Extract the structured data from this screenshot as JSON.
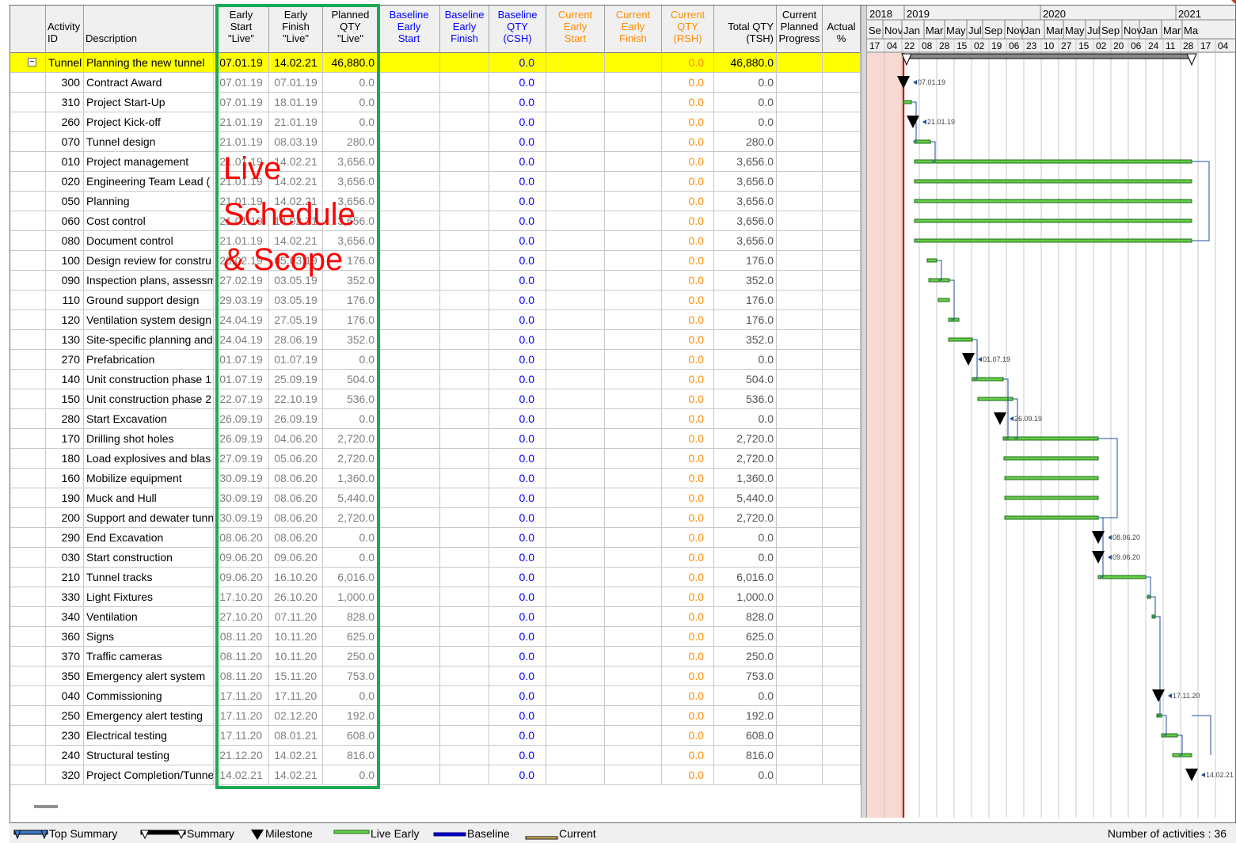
{
  "columns": {
    "id": "Activity\nID",
    "desc": "Description",
    "es": "Early\nStart\n\"Live\"",
    "ef": "Early\nFinish\n\"Live\"",
    "pq": "Planned\nQTY\n\"Live\"",
    "bes": "Baseline\nEarly\nStart",
    "bef": "Baseline\nEarly\nFinish",
    "bq": "Baseline\nQTY\n(CSH)",
    "ces": "Current\nEarly\nStart",
    "cef": "Current\nEarly\nFinish",
    "cq": "Current\nQTY\n(RSH)",
    "tq": "Total QTY\n(TSH)",
    "cpp": "Current\nPlanned\nProgress",
    "ap": "Actual\n%"
  },
  "summary_row": {
    "id": "Tunnel",
    "desc": "Planning the new tunnel",
    "es": "07.01.19",
    "ef": "14.02.21",
    "pq": "46,880.0",
    "bq": "0.0",
    "cq": "0.0",
    "tq": "46,880.0"
  },
  "rows": [
    {
      "id": "300",
      "desc": "Contract Award",
      "es": "07.01.19",
      "ef": "07.01.19",
      "pq": "0.0",
      "bq": "0.0",
      "cq": "0.0",
      "tq": "0.0"
    },
    {
      "id": "310",
      "desc": "Project Start-Up",
      "es": "07.01.19",
      "ef": "18.01.19",
      "pq": "0.0",
      "bq": "0.0",
      "cq": "0.0",
      "tq": "0.0"
    },
    {
      "id": "260",
      "desc": "Project Kick-off",
      "es": "21.01.19",
      "ef": "21.01.19",
      "pq": "0.0",
      "bq": "0.0",
      "cq": "0.0",
      "tq": "0.0"
    },
    {
      "id": "070",
      "desc": "Tunnel design",
      "es": "21.01.19",
      "ef": "08.03.19",
      "pq": "280.0",
      "bq": "0.0",
      "cq": "0.0",
      "tq": "280.0"
    },
    {
      "id": "010",
      "desc": "Project management",
      "es": "21.01.19",
      "ef": "14.02.21",
      "pq": "3,656.0",
      "bq": "0.0",
      "cq": "0.0",
      "tq": "3,656.0"
    },
    {
      "id": "020",
      "desc": "Engineering Team Lead (",
      "es": "21.01.19",
      "ef": "14.02.21",
      "pq": "3,656.0",
      "bq": "0.0",
      "cq": "0.0",
      "tq": "3,656.0"
    },
    {
      "id": "050",
      "desc": "Planning",
      "es": "21.01.19",
      "ef": "14.02.21",
      "pq": "3,656.0",
      "bq": "0.0",
      "cq": "0.0",
      "tq": "3,656.0"
    },
    {
      "id": "060",
      "desc": "Cost control",
      "es": "21.01.19",
      "ef": "14.02.21",
      "pq": "3,656.0",
      "bq": "0.0",
      "cq": "0.0",
      "tq": "3,656.0"
    },
    {
      "id": "080",
      "desc": "Document control",
      "es": "21.01.19",
      "ef": "14.02.21",
      "pq": "3,656.0",
      "bq": "0.0",
      "cq": "0.0",
      "tq": "3,656.0"
    },
    {
      "id": "100",
      "desc": "Design review for constru",
      "es": "20.02.19",
      "ef": "05.03.19",
      "pq": "176.0",
      "bq": "0.0",
      "cq": "0.0",
      "tq": "176.0"
    },
    {
      "id": "090",
      "desc": "Inspection plans, assessm",
      "es": "27.02.19",
      "ef": "03.05.19",
      "pq": "352.0",
      "bq": "0.0",
      "cq": "0.0",
      "tq": "352.0"
    },
    {
      "id": "110",
      "desc": "Ground support design",
      "es": "29.03.19",
      "ef": "03.05.19",
      "pq": "176.0",
      "bq": "0.0",
      "cq": "0.0",
      "tq": "176.0"
    },
    {
      "id": "120",
      "desc": "Ventilation system design",
      "es": "24.04.19",
      "ef": "27.05.19",
      "pq": "176.0",
      "bq": "0.0",
      "cq": "0.0",
      "tq": "176.0"
    },
    {
      "id": "130",
      "desc": "Site-specific planning and",
      "es": "24.04.19",
      "ef": "28.06.19",
      "pq": "352.0",
      "bq": "0.0",
      "cq": "0.0",
      "tq": "352.0"
    },
    {
      "id": "270",
      "desc": "Prefabrication",
      "es": "01.07.19",
      "ef": "01.07.19",
      "pq": "0.0",
      "bq": "0.0",
      "cq": "0.0",
      "tq": "0.0"
    },
    {
      "id": "140",
      "desc": "Unit construction phase 1",
      "es": "01.07.19",
      "ef": "25.09.19",
      "pq": "504.0",
      "bq": "0.0",
      "cq": "0.0",
      "tq": "504.0"
    },
    {
      "id": "150",
      "desc": "Unit construction phase 2",
      "es": "22.07.19",
      "ef": "22.10.19",
      "pq": "536.0",
      "bq": "0.0",
      "cq": "0.0",
      "tq": "536.0"
    },
    {
      "id": "280",
      "desc": "Start Excavation",
      "es": "26.09.19",
      "ef": "26.09.19",
      "pq": "0.0",
      "bq": "0.0",
      "cq": "0.0",
      "tq": "0.0"
    },
    {
      "id": "170",
      "desc": "Drilling shot holes",
      "es": "26.09.19",
      "ef": "04.06.20",
      "pq": "2,720.0",
      "bq": "0.0",
      "cq": "0.0",
      "tq": "2,720.0"
    },
    {
      "id": "180",
      "desc": "Load explosives and blas",
      "es": "27.09.19",
      "ef": "05.06.20",
      "pq": "2,720.0",
      "bq": "0.0",
      "cq": "0.0",
      "tq": "2,720.0"
    },
    {
      "id": "160",
      "desc": "Mobilize equipment",
      "es": "30.09.19",
      "ef": "08.06.20",
      "pq": "1,360.0",
      "bq": "0.0",
      "cq": "0.0",
      "tq": "1,360.0"
    },
    {
      "id": "190",
      "desc": "Muck and Hull",
      "es": "30.09.19",
      "ef": "08.06.20",
      "pq": "5,440.0",
      "bq": "0.0",
      "cq": "0.0",
      "tq": "5,440.0"
    },
    {
      "id": "200",
      "desc": "Support and dewater tunn",
      "es": "30.09.19",
      "ef": "08.06.20",
      "pq": "2,720.0",
      "bq": "0.0",
      "cq": "0.0",
      "tq": "2,720.0"
    },
    {
      "id": "290",
      "desc": "End Excavation",
      "es": "08.06.20",
      "ef": "08.06.20",
      "pq": "0.0",
      "bq": "0.0",
      "cq": "0.0",
      "tq": "0.0"
    },
    {
      "id": "030",
      "desc": "Start construction",
      "es": "09.06.20",
      "ef": "09.06.20",
      "pq": "0.0",
      "bq": "0.0",
      "cq": "0.0",
      "tq": "0.0"
    },
    {
      "id": "210",
      "desc": "Tunnel tracks",
      "es": "09.06.20",
      "ef": "16.10.20",
      "pq": "6,016.0",
      "bq": "0.0",
      "cq": "0.0",
      "tq": "6,016.0"
    },
    {
      "id": "330",
      "desc": "Light Fixtures",
      "es": "17.10.20",
      "ef": "26.10.20",
      "pq": "1,000.0",
      "bq": "0.0",
      "cq": "0.0",
      "tq": "1,000.0"
    },
    {
      "id": "340",
      "desc": "Ventilation",
      "es": "27.10.20",
      "ef": "07.11.20",
      "pq": "828.0",
      "bq": "0.0",
      "cq": "0.0",
      "tq": "828.0"
    },
    {
      "id": "360",
      "desc": "Signs",
      "es": "08.11.20",
      "ef": "10.11.20",
      "pq": "625.0",
      "bq": "0.0",
      "cq": "0.0",
      "tq": "625.0"
    },
    {
      "id": "370",
      "desc": "Traffic cameras",
      "es": "08.11.20",
      "ef": "10.11.20",
      "pq": "250.0",
      "bq": "0.0",
      "cq": "0.0",
      "tq": "250.0"
    },
    {
      "id": "350",
      "desc": "Emergency alert system",
      "es": "08.11.20",
      "ef": "15.11.20",
      "pq": "753.0",
      "bq": "0.0",
      "cq": "0.0",
      "tq": "753.0"
    },
    {
      "id": "040",
      "desc": "Commissioning",
      "es": "17.11.20",
      "ef": "17.11.20",
      "pq": "0.0",
      "bq": "0.0",
      "cq": "0.0",
      "tq": "0.0"
    },
    {
      "id": "250",
      "desc": "Emergency alert testing",
      "es": "17.11.20",
      "ef": "02.12.20",
      "pq": "192.0",
      "bq": "0.0",
      "cq": "0.0",
      "tq": "192.0"
    },
    {
      "id": "230",
      "desc": "Electrical testing",
      "es": "17.11.20",
      "ef": "08.01.21",
      "pq": "608.0",
      "bq": "0.0",
      "cq": "0.0",
      "tq": "608.0"
    },
    {
      "id": "240",
      "desc": "Structural testing",
      "es": "21.12.20",
      "ef": "14.02.21",
      "pq": "816.0",
      "bq": "0.0",
      "cq": "0.0",
      "tq": "816.0"
    },
    {
      "id": "320",
      "desc": "Project Completion/Tunne",
      "es": "14.02.21",
      "ef": "14.02.21",
      "pq": "0.0",
      "bq": "0.0",
      "cq": "0.0",
      "tq": "0.0"
    }
  ],
  "gantt": {
    "years": [
      "2018",
      "2019",
      "2020",
      "2021"
    ],
    "months": [
      "Se",
      "Nov",
      "Jan",
      "Mar",
      "May",
      "Jul",
      "Sep",
      "Nov",
      "Jan",
      "Mar",
      "May",
      "Jul",
      "Sep",
      "Nov",
      "Jan",
      "Mar",
      "Ma"
    ],
    "days": [
      "17",
      "04",
      "22",
      "08",
      "28",
      "15",
      "02",
      "19",
      "06",
      "23",
      "10",
      "27",
      "15",
      "02",
      "20",
      "06",
      "24",
      "11",
      "28",
      "17",
      "04"
    ],
    "milestone_labels": [
      "07.01.19",
      "21.01.19",
      "01.07.19",
      "26.09.19",
      "08.06.20",
      "09.06.20",
      "17.11.20",
      "14.02.21"
    ]
  },
  "annotation": {
    "line1": "Live",
    "line2": "Schedule",
    "line3": "& Scope"
  },
  "legend": {
    "top_summary": "Top Summary",
    "summary": "Summary",
    "milestone": "Milestone",
    "live_early": "Live Early",
    "baseline": "Baseline",
    "current": "Current",
    "count": "Number of activities : 36"
  },
  "colors": {
    "summary_highlight": "#ffff00",
    "annotation_box": "#1aaa55",
    "annotation_text": "#ff0000",
    "live_bar": "#66cc44",
    "baseline_text": "#0000ff",
    "current_text": "#ff8c00",
    "today_line": "#cc0000",
    "today_band": "#f8d8d0"
  }
}
